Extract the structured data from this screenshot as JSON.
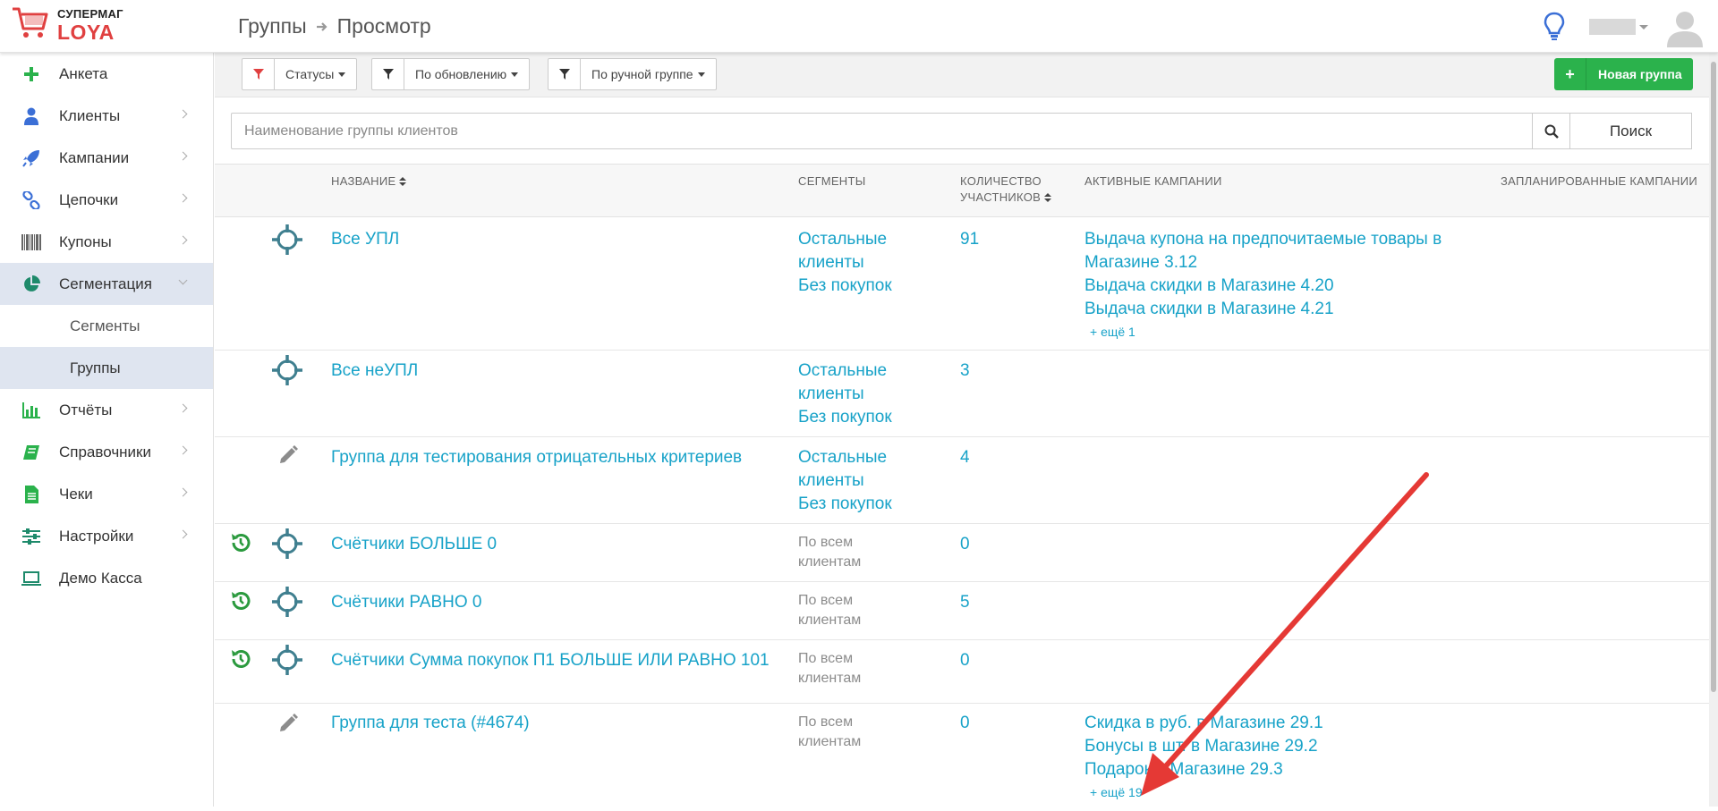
{
  "app": {
    "logo_top": "СУПЕРМАГ",
    "logo_bottom": "LOYA"
  },
  "breadcrumb": {
    "section": "Группы",
    "page": "Просмотр"
  },
  "sidebar": {
    "items": [
      {
        "label": "Анкета",
        "icon": "plus-icon"
      },
      {
        "label": "Клиенты",
        "icon": "user-icon"
      },
      {
        "label": "Кампании",
        "icon": "rocket-icon"
      },
      {
        "label": "Цепочки",
        "icon": "chain-icon"
      },
      {
        "label": "Купоны",
        "icon": "barcode-icon"
      },
      {
        "label": "Сегментация",
        "icon": "pie-chart-icon"
      },
      {
        "label": "Сегменты"
      },
      {
        "label": "Группы"
      },
      {
        "label": "Отчёты",
        "icon": "bar-chart-icon"
      },
      {
        "label": "Справочники",
        "icon": "book-icon"
      },
      {
        "label": "Чеки",
        "icon": "receipt-icon"
      },
      {
        "label": "Настройки",
        "icon": "sliders-icon"
      },
      {
        "label": "Демо Касса",
        "icon": "laptop-icon"
      }
    ]
  },
  "filters": {
    "statuses": "Статусы",
    "by_update": "По обновлению",
    "by_manual_group": "По ручной группе",
    "new_group": "Новая группа"
  },
  "search": {
    "placeholder": "Наименование группы клиентов",
    "button": "Поиск"
  },
  "table": {
    "headers": {
      "name": "НАЗВАНИЕ",
      "segments": "СЕГМЕНТЫ",
      "count_line1": "КОЛИЧЕСТВО",
      "count_line2": "УЧАСТНИКОВ",
      "active": "АКТИВНЫЕ КАМПАНИИ",
      "planned": "ЗАПЛАНИРОВАННЫЕ КАМПАНИИ"
    },
    "rows": [
      {
        "name": "Все УПЛ",
        "segments": [
          "Остальные клиенты",
          "Без покупок"
        ],
        "count": "91",
        "campaigns": [
          "Выдача купона на предпочитаемые товары в Магазине 3.12",
          "Выдача скидки в Магазине 4.20",
          "Выдача скидки в Магазине 4.21"
        ],
        "more": "+ ещё 1"
      },
      {
        "name": "Все неУПЛ",
        "segments": [
          "Остальные клиенты",
          "Без покупок"
        ],
        "count": "3"
      },
      {
        "name": "Группа для тестирования отрицательных критериев",
        "segments": [
          "Остальные клиенты",
          "Без покупок"
        ],
        "count": "4"
      },
      {
        "name": "Счётчики БОЛЬШЕ 0",
        "segment_text": "По всем клиентам",
        "count": "0"
      },
      {
        "name": "Счётчики РАВНО 0",
        "segment_text": "По всем клиентам",
        "count": "5"
      },
      {
        "name": "Счётчики Сумма покупок П1 БОЛЬШЕ ИЛИ РАВНО 101",
        "segment_text": "По всем клиентам",
        "count": "0"
      },
      {
        "name": "Группа для теста (#4674)",
        "segment_text": "По всем клиентам",
        "count": "0",
        "campaigns": [
          "Скидка в руб. в Магазине 29.1",
          "Бонусы в шт. в Магазине 29.2",
          "Подарок в Магазине 29.3"
        ],
        "more": "+ ещё 19"
      }
    ]
  },
  "colors": {
    "link": "#17a2c8",
    "accent_green": "#2bb24c",
    "annotation_red": "#e53935"
  }
}
